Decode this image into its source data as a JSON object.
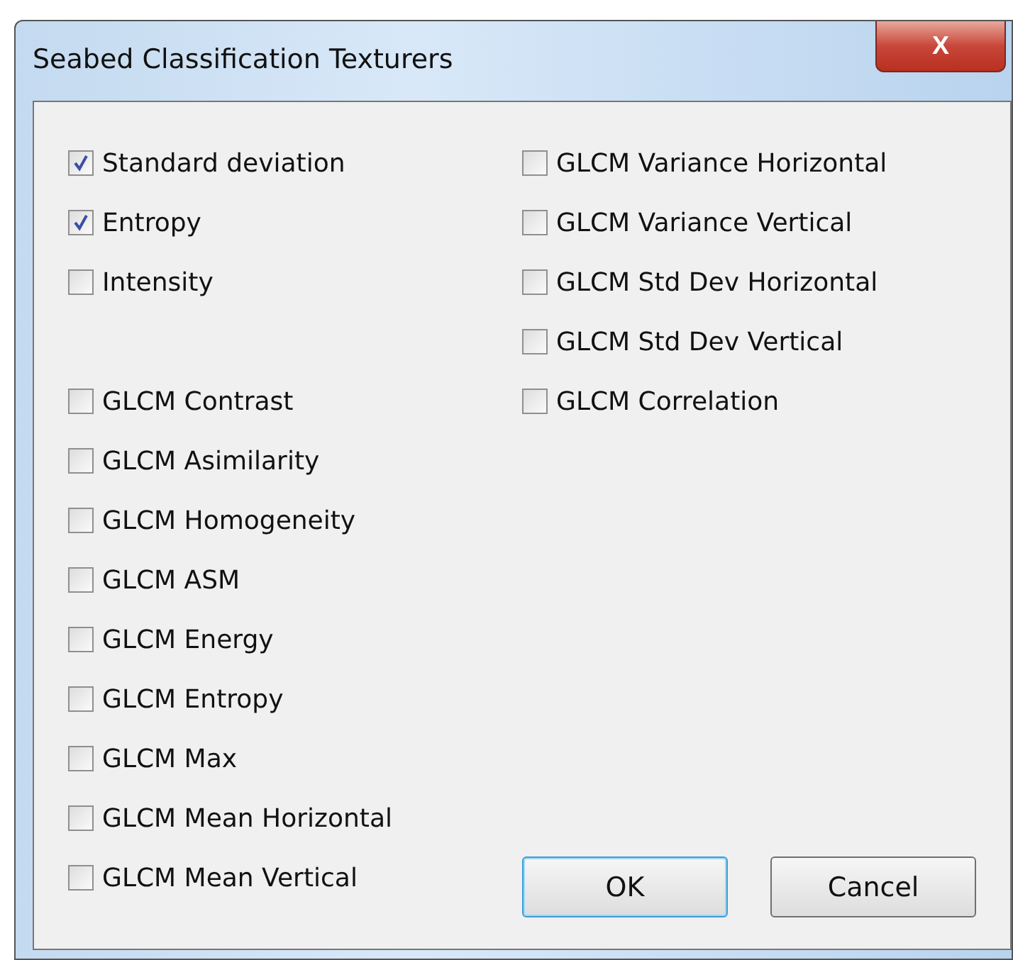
{
  "window": {
    "title": "Seabed Classification Texturers",
    "close": "X"
  },
  "left_groups": [
    {
      "items": [
        {
          "label": "Standard deviation",
          "checked": true
        },
        {
          "label": "Entropy",
          "checked": true
        },
        {
          "label": "Intensity",
          "checked": false
        }
      ]
    },
    {
      "items": [
        {
          "label": "GLCM Contrast",
          "checked": false
        },
        {
          "label": "GLCM Asimilarity",
          "checked": false
        },
        {
          "label": "GLCM Homogeneity",
          "checked": false
        },
        {
          "label": "GLCM ASM",
          "checked": false
        },
        {
          "label": "GLCM Energy",
          "checked": false
        },
        {
          "label": "GLCM Entropy",
          "checked": false
        },
        {
          "label": "GLCM Max",
          "checked": false
        },
        {
          "label": "GLCM Mean Horizontal",
          "checked": false
        },
        {
          "label": "GLCM Mean Vertical",
          "checked": false
        }
      ]
    }
  ],
  "right_items": [
    {
      "label": "GLCM Variance Horizontal",
      "checked": false
    },
    {
      "label": "GLCM Variance Vertical",
      "checked": false
    },
    {
      "label": "GLCM Std Dev Horizontal",
      "checked": false
    },
    {
      "label": "GLCM Std Dev Vertical",
      "checked": false
    },
    {
      "label": "GLCM Correlation",
      "checked": false
    }
  ],
  "buttons": [
    {
      "label": "OK",
      "default": true
    },
    {
      "label": "Cancel",
      "default": false
    }
  ]
}
